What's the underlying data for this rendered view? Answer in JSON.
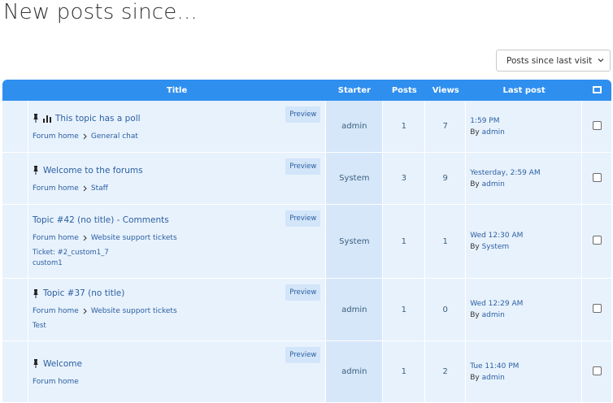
{
  "page": {
    "title": "New posts since..."
  },
  "filter": {
    "selected": "Posts since last visit"
  },
  "table": {
    "columns": {
      "title": "Title",
      "starter": "Starter",
      "posts": "Posts",
      "views": "Views",
      "last_post": "Last post"
    },
    "preview_label": "Preview",
    "rows": [
      {
        "title": "This topic has a poll",
        "icons": [
          "pin-icon",
          "poll-icon"
        ],
        "crumbs": [
          "Forum home",
          "General chat"
        ],
        "extra": [],
        "starter": "admin",
        "posts": "1",
        "views": "7",
        "last_time": "1:59 PM",
        "last_by_prefix": "By",
        "last_by": "admin"
      },
      {
        "title": "Welcome to the forums",
        "icons": [
          "pin-icon"
        ],
        "crumbs": [
          "Forum home",
          "Staff"
        ],
        "extra": [],
        "starter": "System",
        "posts": "3",
        "views": "9",
        "last_time": "Yesterday, 2:59 AM",
        "last_by_prefix": "By",
        "last_by": "admin"
      },
      {
        "title": "Topic #42 (no title) - Comments",
        "icons": [],
        "crumbs": [
          "Forum home",
          "Website support tickets"
        ],
        "extra": [
          "Ticket: #2_custom1_7",
          "custom1"
        ],
        "starter": "System",
        "posts": "1",
        "views": "1",
        "last_time": "Wed 12:30 AM",
        "last_by_prefix": "By",
        "last_by": "System"
      },
      {
        "title": "Topic #37 (no title)",
        "icons": [
          "pin-icon"
        ],
        "crumbs": [
          "Forum home",
          "Website support tickets"
        ],
        "extra": [
          "Test"
        ],
        "starter": "admin",
        "posts": "1",
        "views": "0",
        "last_time": "Wed 12:29 AM",
        "last_by_prefix": "By",
        "last_by": "admin"
      },
      {
        "title": "Welcome",
        "icons": [
          "pin-icon"
        ],
        "crumbs": [
          "Forum home"
        ],
        "extra": [],
        "starter": "admin",
        "posts": "1",
        "views": "2",
        "last_time": "Tue 11:40 PM",
        "last_by_prefix": "By",
        "last_by": "admin"
      }
    ]
  },
  "colors": {
    "header_bg": "#2f8fef",
    "row_bg": "#e8f2fd",
    "starter_bg": "#d6e7fa",
    "link": "#2b5fa0"
  }
}
